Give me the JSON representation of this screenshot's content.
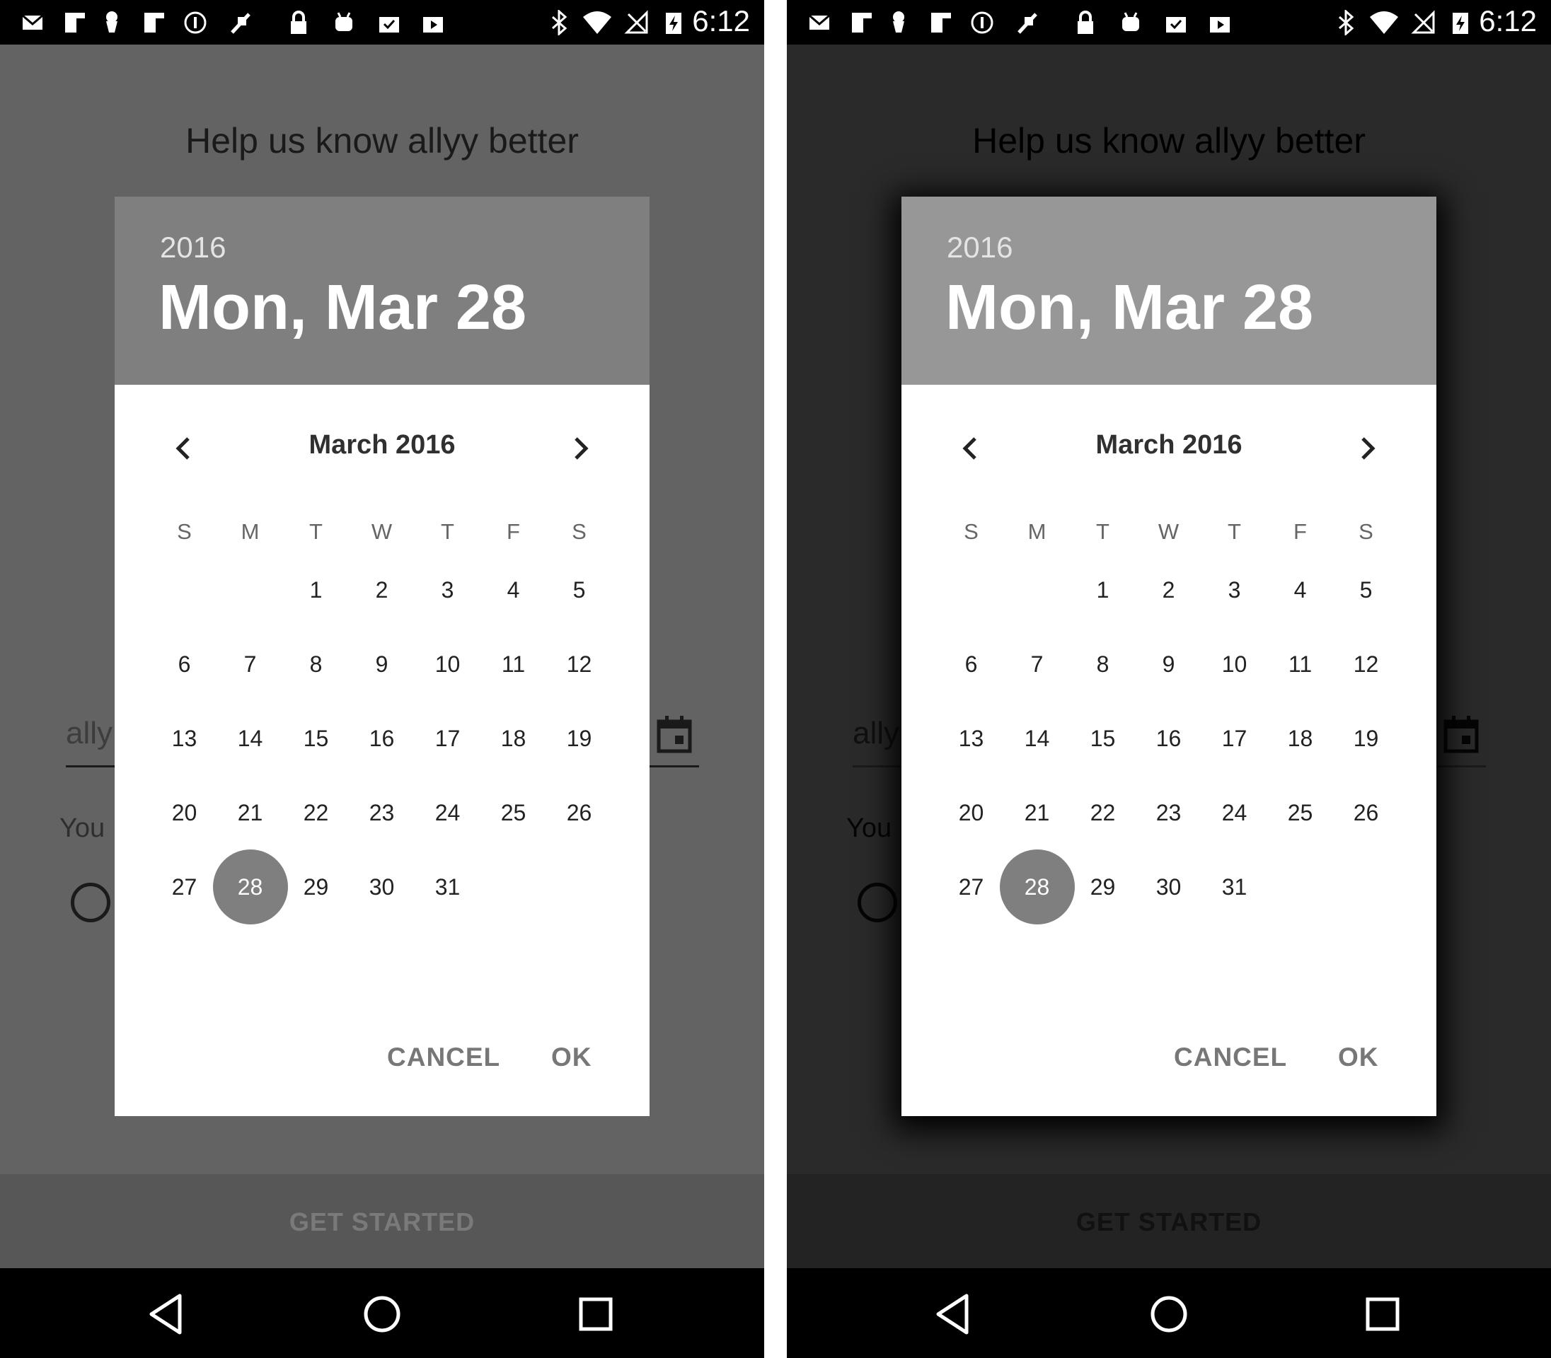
{
  "status_bar": {
    "time": "6:12",
    "left_icons": [
      "mail-icon",
      "flipboard-icon",
      "pin-icon",
      "flipboard-icon",
      "info-icon",
      "fake-gps-icon",
      "lock-icon",
      "android-icon",
      "clipboard-check-icon",
      "play-store-icon"
    ],
    "right_icons": [
      "bluetooth-icon",
      "wifi-icon",
      "no-signal-icon",
      "battery-charging-icon"
    ]
  },
  "screen": {
    "heading": "Help us know allyy better",
    "field_text": "ally",
    "label_text": "You",
    "get_started": "GET STARTED"
  },
  "date_picker": {
    "year": "2016",
    "selected_date": "Mon, Mar 28",
    "month_title": "March 2016",
    "weekdays": [
      "S",
      "M",
      "T",
      "W",
      "T",
      "F",
      "S"
    ],
    "first_weekday_index": 2,
    "days_in_month": 31,
    "selected_day": 28,
    "cancel_label": "CANCEL",
    "ok_label": "OK"
  },
  "colors": {
    "header_left": "#7f7f7f",
    "header_right": "#979797",
    "selected_circle": "#7f7f7f"
  }
}
